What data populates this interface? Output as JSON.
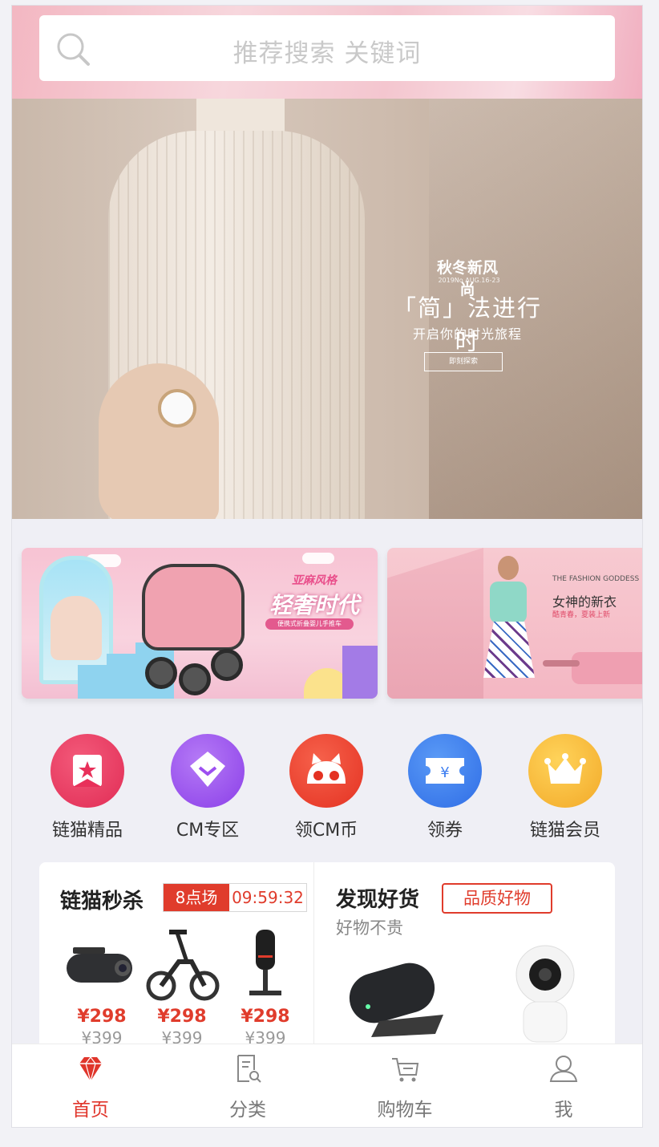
{
  "search": {
    "placeholder": "推荐搜索 关键词"
  },
  "hero": {
    "brand": "秋冬新风尚",
    "date_line": "2019No AUG.16-23",
    "title": "「简」法进行时",
    "subtitle": "开启你的时光旅程",
    "cta": "即刻探索"
  },
  "banners": [
    {
      "headline_small": "亚麻风格",
      "headline_big": "轻奢时代",
      "tag": "便携式折叠婴儿手推车"
    },
    {
      "eyebrow": "THE FASHION GODDESS",
      "headline": "女神的新衣",
      "tag": "酷青春，夏装上新"
    }
  ],
  "shortcuts": [
    {
      "label": "链猫精品",
      "icon": "bookmark-star-icon",
      "color": "#e8305a"
    },
    {
      "label": "CM专区",
      "icon": "diamond-icon",
      "color": "#9d4ff0"
    },
    {
      "label": "领CM币",
      "icon": "cat-face-icon",
      "color": "#ec3b2a"
    },
    {
      "label": "领券",
      "icon": "coupon-yen-icon",
      "color": "#3d7ef0"
    },
    {
      "label": "链猫会员",
      "icon": "crown-icon",
      "color": "#f5b932"
    }
  ],
  "flash_sale": {
    "title": "链猫秒杀",
    "session": "8点场",
    "countdown": "09:59:32",
    "products": [
      {
        "name": "dashcam",
        "price": "¥298",
        "old_price": "¥399"
      },
      {
        "name": "e-bike",
        "price": "¥298",
        "old_price": "¥399"
      },
      {
        "name": "microphone",
        "price": "¥298",
        "old_price": "¥399"
      }
    ]
  },
  "discover": {
    "title": "发现好货",
    "badge": "品质好物",
    "subtitle": "好物不贵"
  },
  "tabbar": {
    "items": [
      {
        "label": "首页",
        "icon": "diamond-home-icon",
        "active": true
      },
      {
        "label": "分类",
        "icon": "document-search-icon",
        "active": false
      },
      {
        "label": "购物车",
        "icon": "cart-icon",
        "active": false
      },
      {
        "label": "我",
        "icon": "user-icon",
        "active": false
      }
    ]
  },
  "colors": {
    "accent": "#e0352b"
  }
}
